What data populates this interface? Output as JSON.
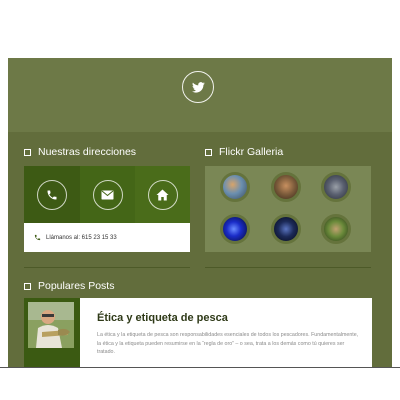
{
  "social": {
    "twitter_icon": "twitter-bird-icon"
  },
  "addresses": {
    "title": "Nuestras direcciones",
    "icons": [
      "phone-icon",
      "envelope-icon",
      "home-icon"
    ],
    "phone_text": "Llámanos al: 615 23 15 33"
  },
  "flickr": {
    "title": "Flickr Galleria",
    "thumbnails": [
      "flickr-thumb-1",
      "flickr-thumb-2",
      "flickr-thumb-3",
      "flickr-thumb-4",
      "flickr-thumb-5",
      "flickr-thumb-6"
    ]
  },
  "popular": {
    "title": "Populares Posts",
    "post": {
      "title": "Ética y etiqueta de pesca",
      "excerpt": "La ética y la etiqueta de pesca son responsabilidades esenciales de todos los pescadores. Fundamentalmente, la ética y la etiqueta pueden resumirse en la “regla de oro” – o sea, trata a los demás como tú quieres ser tratado."
    }
  },
  "colors": {
    "panel": "#6b7745",
    "body": "#626d3c",
    "accent_dark": "#3d5a14",
    "title_text": "#2f3a18"
  }
}
